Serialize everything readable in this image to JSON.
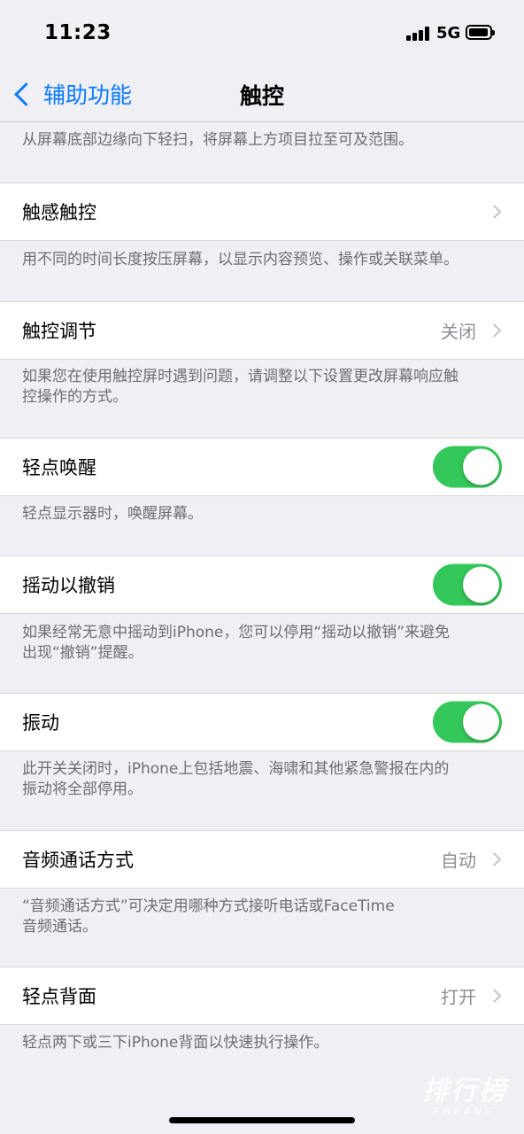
{
  "status_bar": {
    "time": "11:23",
    "network": "5G"
  },
  "nav": {
    "back_label": "辅助功能",
    "title": "触控"
  },
  "top_note": "从屏幕底部边缘向下轻扫，将屏幕上方项目拉至可及范围。",
  "rows": [
    {
      "label": "触感触控",
      "value": "",
      "type": "disclosure",
      "footer": [
        "用不同的时间长度按压屏幕，以显示内容预览、操作或关联菜单。"
      ]
    },
    {
      "label": "触控调节",
      "value": "关闭",
      "type": "disclosure",
      "footer": [
        "如果您在使用触控屏时遇到问题，请调整以下设置更改屏幕响应触",
        "控操作的方式。"
      ]
    },
    {
      "label": "轻点唤醒",
      "type": "toggle",
      "state": "on",
      "footer": [
        "轻点显示器时，唤醒屏幕。"
      ]
    },
    {
      "label": "摇动以撤销",
      "type": "toggle",
      "state": "on",
      "footer": [
        "如果经常无意中摇动到iPhone，您可以停用“摇动以撤销”来避免",
        "出现“撤销”提醒。"
      ]
    },
    {
      "label": "振动",
      "type": "toggle",
      "state": "on",
      "footer": [
        "此开关关闭时，iPhone上包括地震、海啸和其他紧急警报在内的",
        "振动将全部停用。"
      ]
    },
    {
      "label": "音频通话方式",
      "value": "自动",
      "type": "disclosure",
      "footer": [
        "“音频通话方式”可决定用哪种方式接听电话或FaceTime",
        "音频通话。"
      ]
    },
    {
      "label": "轻点背面",
      "value": "打开",
      "type": "disclosure",
      "footer": [
        "轻点两下或三下iPhone背面以快速执行操作。"
      ]
    }
  ],
  "watermark": {
    "main": "排行榜",
    "sub": "PHBANG"
  },
  "colors": {
    "accent": "#0a7aff",
    "toggle_on": "#34c759",
    "background": "#efeff4",
    "secondary_text": "#6d6d72"
  },
  "icons": {
    "back": "chevron-left-icon",
    "disclosure": "chevron-right-icon"
  }
}
